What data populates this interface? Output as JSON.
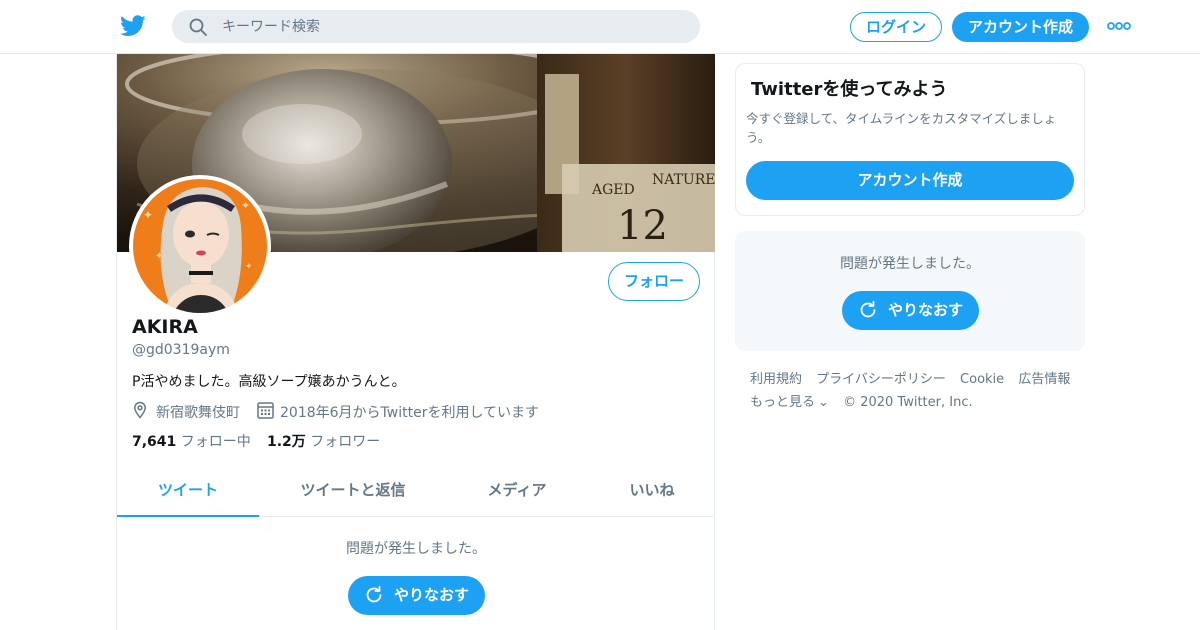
{
  "header": {
    "logo_icon": "twitter-bird-icon",
    "search_placeholder": "キーワード検索",
    "login_label": "ログイン",
    "signup_label": "アカウント作成",
    "more_icon": "more-dots-icon"
  },
  "profile": {
    "name": "AKIRA",
    "handle": "@gd0319aym",
    "bio": "P活やめました。高級ソープ嬢あかうんと。",
    "location": "新宿歌舞伎町",
    "joined": "2018年6月からTwitterを利用しています",
    "follow_label": "フォロー",
    "following_count": "7,641",
    "following_label": "フォロー中",
    "followers_count": "1.2万",
    "followers_label": "フォロワー"
  },
  "tabs": [
    {
      "label": "ツイート",
      "active": true
    },
    {
      "label": "ツイートと返信",
      "active": false
    },
    {
      "label": "メディア",
      "active": false
    },
    {
      "label": "いいね",
      "active": false
    }
  ],
  "timeline": {
    "error_message": "問題が発生しました。",
    "retry_label": "やりなおす"
  },
  "sidebar": {
    "signup_title": "Twitterを使ってみよう",
    "signup_desc": "今すぐ登録して、タイムラインをカスタマイズしましょう。",
    "signup_button": "アカウント作成",
    "error_message": "問題が発生しました。",
    "retry_label": "やりなおす"
  },
  "footer": {
    "links": [
      "利用規約",
      "プライバシーポリシー",
      "Cookie",
      "広告情報"
    ],
    "more_label": "もっと見る",
    "copyright": "© 2020 Twitter, Inc."
  },
  "colors": {
    "accent": "#1da1f2",
    "text_primary": "#14171a",
    "text_secondary": "#657786"
  }
}
